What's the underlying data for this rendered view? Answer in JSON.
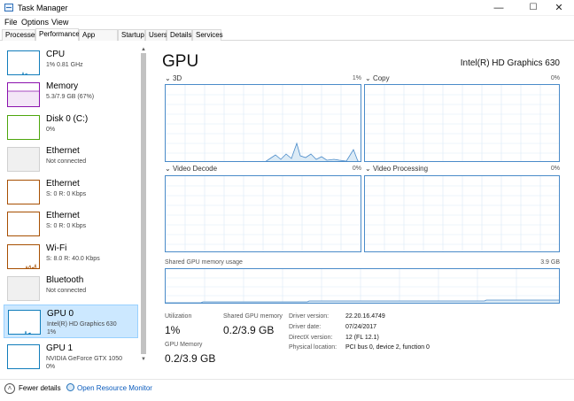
{
  "window": {
    "title": "Task Manager",
    "minimize": "—",
    "maximize": "☐",
    "close": "✕"
  },
  "menu": [
    "File",
    "Options",
    "View"
  ],
  "tabs": [
    "Processes",
    "Performance",
    "App history",
    "Startup",
    "Users",
    "Details",
    "Services"
  ],
  "sidebar": {
    "items": [
      {
        "title": "CPU",
        "sub": "1% 0.81 GHz",
        "color": "#117dbb"
      },
      {
        "title": "Memory",
        "sub": "5.3/7.9 GB (67%)",
        "color": "#8b12ae"
      },
      {
        "title": "Disk 0 (C:)",
        "sub": "0%",
        "color": "#4da60c"
      },
      {
        "title": "Ethernet",
        "sub": "Not connected",
        "color": "#bdbdbd"
      },
      {
        "title": "Ethernet",
        "sub": "S: 0  R: 0 Kbps",
        "color": "#a74f01"
      },
      {
        "title": "Ethernet",
        "sub": "S: 0  R: 0 Kbps",
        "color": "#a74f01"
      },
      {
        "title": "Wi-Fi",
        "sub": "S: 8.0  R: 40.0 Kbps",
        "color": "#a74f01"
      },
      {
        "title": "Bluetooth",
        "sub": "Not connected",
        "color": "#bdbdbd"
      },
      {
        "title": "GPU 0",
        "sub": "Intel(R) HD Graphics 630",
        "sub2": "1%",
        "color": "#117dbb"
      },
      {
        "title": "GPU 1",
        "sub": "NVIDIA GeForce GTX 1050",
        "sub2": "0%",
        "color": "#117dbb"
      }
    ]
  },
  "footer": {
    "fewer_details": "Fewer details",
    "open_monitor": "Open Resource Monitor"
  },
  "main": {
    "title": "GPU",
    "gpu_name": "Intel(R) HD Graphics 630",
    "graphs": [
      {
        "label": "3D",
        "percent": "1%"
      },
      {
        "label": "Copy",
        "percent": "0%"
      },
      {
        "label": "Video Decode",
        "percent": "0%"
      },
      {
        "label": "Video Processing",
        "percent": "0%"
      }
    ],
    "shared_memory": {
      "label": "Shared GPU memory usage",
      "max": "3.9 GB"
    },
    "stats": {
      "utilization_label": "Utilization",
      "utilization_value": "1%",
      "shared_label": "Shared GPU memory",
      "shared_value": "0.2/3.9 GB",
      "gpu_memory_label": "GPU Memory",
      "gpu_memory_value": "0.2/3.9 GB"
    },
    "info": [
      {
        "key": "Driver version:",
        "value": "22.20.16.4749"
      },
      {
        "key": "Driver date:",
        "value": "07/24/2017"
      },
      {
        "key": "DirectX version:",
        "value": "12 (FL 12.1)"
      },
      {
        "key": "Physical location:",
        "value": "PCI bus 0, device 2, function 0"
      }
    ]
  }
}
